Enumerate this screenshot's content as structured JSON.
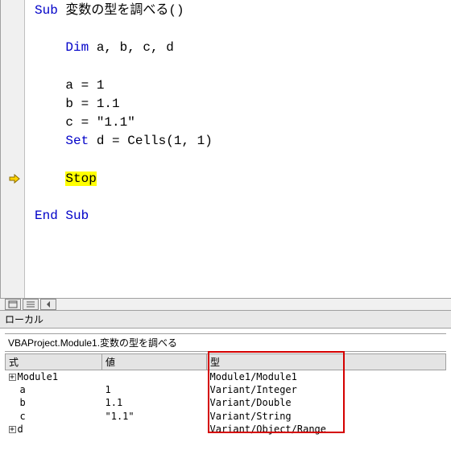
{
  "code": {
    "lines": [
      {
        "kw": "Sub",
        "rest": " 変数の型を調べる()",
        "kind": "sub"
      },
      {
        "kind": "blank"
      },
      {
        "kw": "Dim",
        "rest": " a, b, c, d",
        "kind": "dim",
        "indent": true
      },
      {
        "kind": "blank"
      },
      {
        "txt": "a = 1",
        "kind": "plain",
        "indent": true
      },
      {
        "txt": "b = 1.1",
        "kind": "plain",
        "indent": true
      },
      {
        "txt": "c = \"1.1\"",
        "kind": "plain",
        "indent": true
      },
      {
        "kw": "Set",
        "rest": " d = Cells(1, 1)",
        "kind": "set",
        "indent": true
      },
      {
        "kind": "blank"
      },
      {
        "txt": "Stop",
        "kind": "stop",
        "indent": true
      },
      {
        "kind": "blank"
      },
      {
        "kw": "End Sub",
        "kind": "endsub"
      }
    ],
    "exec_line_index": 9
  },
  "locals": {
    "title": "ローカル",
    "context": "VBAProject.Module1.変数の型を調べる",
    "cols": {
      "expr": "式",
      "value": "値",
      "type": "型"
    },
    "rows": [
      {
        "expand": true,
        "child": false,
        "name": "Module1",
        "value": "",
        "type": "Module1/Module1"
      },
      {
        "expand": false,
        "child": true,
        "name": "a",
        "value": "1",
        "type": "Variant/Integer"
      },
      {
        "expand": false,
        "child": true,
        "name": "b",
        "value": "1.1",
        "type": "Variant/Double"
      },
      {
        "expand": false,
        "child": true,
        "name": "c",
        "value": "\"1.1\"",
        "type": "Variant/String"
      },
      {
        "expand": true,
        "child": false,
        "name": "d",
        "value": "",
        "type": "Variant/Object/Range"
      }
    ]
  }
}
